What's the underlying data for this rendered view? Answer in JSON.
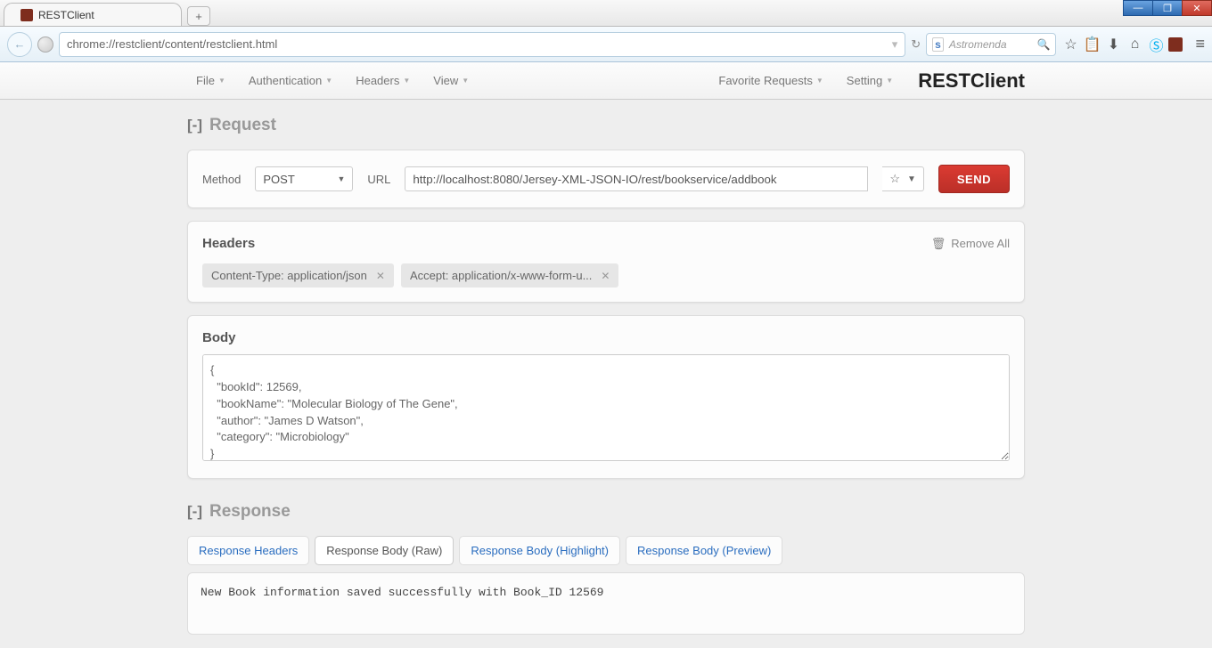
{
  "browser": {
    "tab_title": "RESTClient",
    "url": "chrome://restclient/content/restclient.html",
    "search_placeholder": "Astromenda"
  },
  "appbar": {
    "menus": [
      "File",
      "Authentication",
      "Headers",
      "View"
    ],
    "right_menus": [
      "Favorite Requests",
      "Setting"
    ],
    "brand": "RESTClient"
  },
  "request": {
    "section_title": "Request",
    "method_label": "Method",
    "method_value": "POST",
    "url_label": "URL",
    "url_value": "http://localhost:8080/Jersey-XML-JSON-IO/rest/bookservice/addbook",
    "send_label": "SEND"
  },
  "headers": {
    "title": "Headers",
    "remove_all": "Remove All",
    "items": [
      "Content-Type: application/json",
      "Accept: application/x-www-form-u..."
    ]
  },
  "body": {
    "title": "Body",
    "text": "{\n  \"bookId\": 12569,\n  \"bookName\": \"Molecular Biology of The Gene\",\n  \"author\": \"James D Watson\",\n  \"category\": \"Microbiology\"\n}"
  },
  "response": {
    "section_title": "Response",
    "tabs": [
      "Response Headers",
      "Response Body (Raw)",
      "Response Body (Highlight)",
      "Response Body (Preview)"
    ],
    "active_tab_index": 1,
    "body": "New Book information saved successfully with Book_ID 12569"
  }
}
